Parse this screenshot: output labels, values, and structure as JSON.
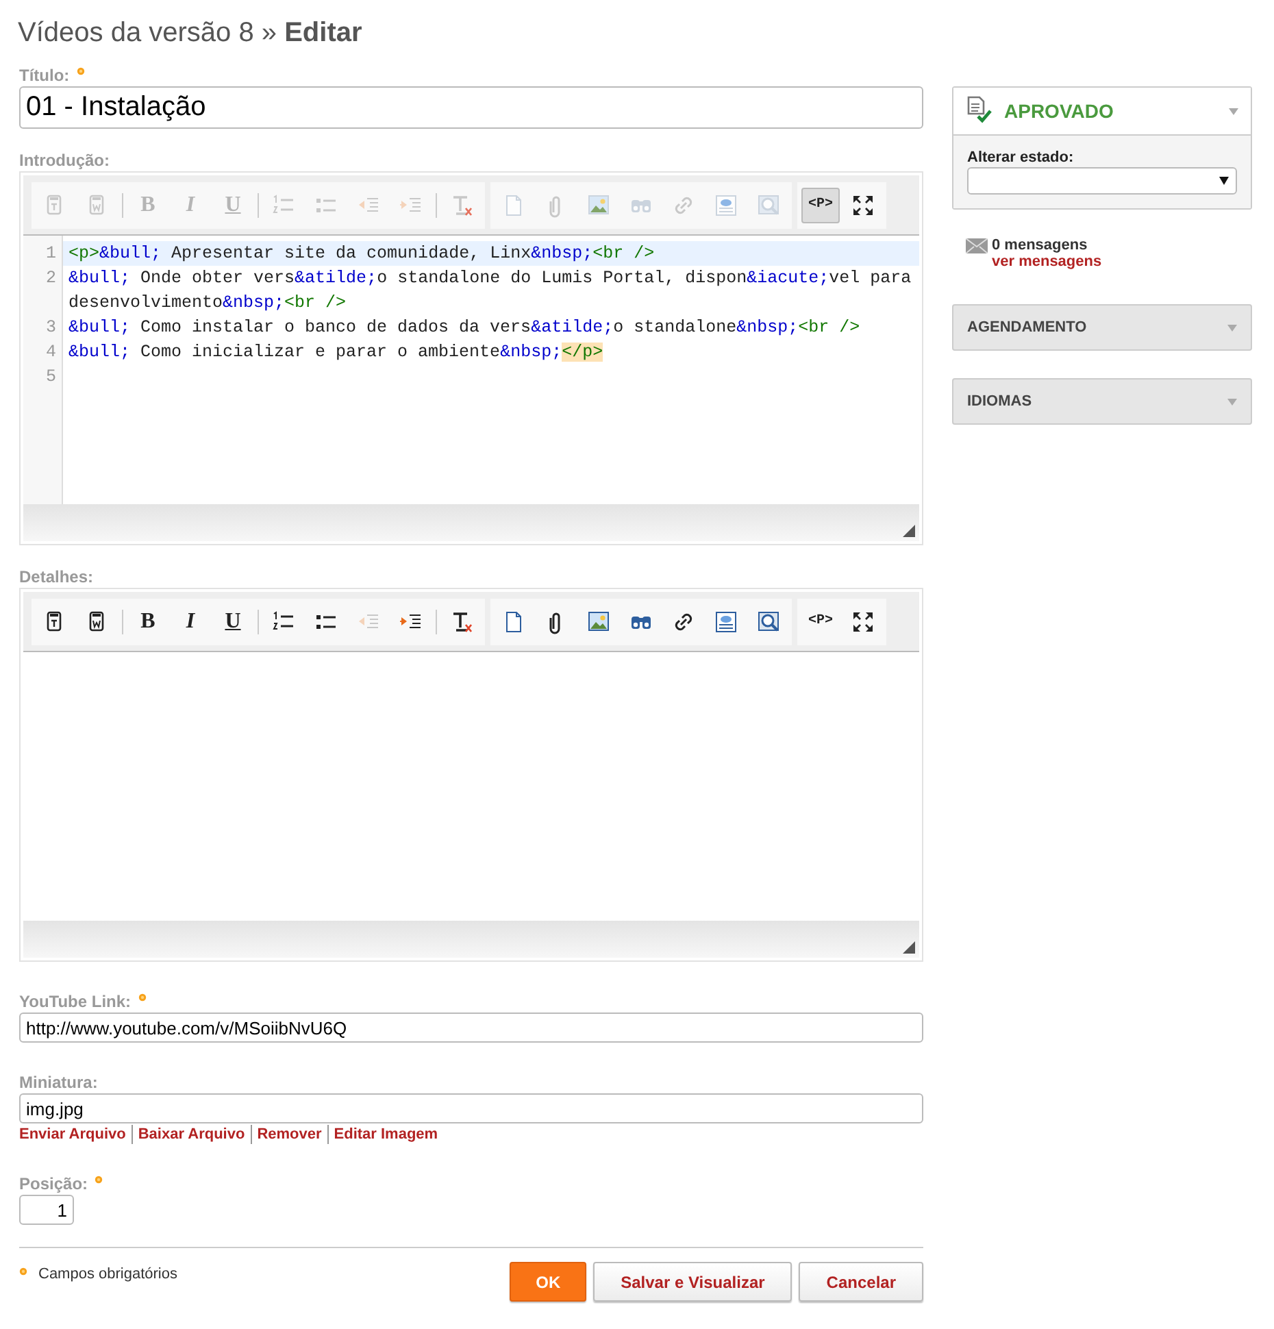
{
  "page_title": "Vídeos da versão 8 » **Editar**",
  "title_field": {
    "label": "Título:",
    "required": true,
    "value": "01 - Instalação"
  },
  "editors": [
    {
      "label": "Introdução:",
      "toolbar": [
        [
          {
            "disabled": true
          },
          {
            "disabled": true
          },
          {
            "label": "B",
            "disabled": true,
            "separated": true
          },
          {
            "label": "I",
            "disabled": true
          },
          {
            "label": "U",
            "disabled": true
          },
          {
            "disabled": true,
            "separated": true
          },
          {
            "disabled": true
          },
          {
            "disabled": true
          },
          {
            "disabled": true
          },
          {
            "disabled": true,
            "separated": true
          }
        ],
        [
          {
            "disabled": true
          },
          {
            "disabled": true
          },
          {
            "disabled": true
          },
          {
            "disabled": true
          },
          {
            "disabled": true
          },
          {
            "disabled": true
          },
          {
            "disabled": true
          }
        ],
        [
          {
            "label": "<P>",
            "disabled": false,
            "selected": true
          },
          {
            "disabled": false
          }
        ]
      ],
      "code_lines": [
        {
          "number": "1",
          "active": true,
          "segments": [
            {
              "kind": "tag",
              "text": "<p>"
            },
            {
              "kind": "entity",
              "text": "&bull;"
            },
            {
              "kind": "text",
              "text": " Apresentar site da comunidade, Linx"
            },
            {
              "kind": "entity",
              "text": "&nbsp;"
            },
            {
              "kind": "tag",
              "text": "<br />"
            }
          ]
        },
        {
          "number": "2",
          "active": false,
          "segments": [
            {
              "kind": "entity",
              "text": "&bull;"
            },
            {
              "kind": "text",
              "text": " Onde obter vers"
            },
            {
              "kind": "entity",
              "text": "&atilde;"
            },
            {
              "kind": "text",
              "text": "o standalone do Lumis Portal, dispon"
            },
            {
              "kind": "entity",
              "text": "&iacute;"
            },
            {
              "kind": "text",
              "text": "vel para desenvolvimento"
            },
            {
              "kind": "entity",
              "text": "&nbsp;"
            },
            {
              "kind": "tag",
              "text": "<br />"
            }
          ]
        },
        {
          "number": "3",
          "active": false,
          "segments": [
            {
              "kind": "entity",
              "text": "&bull;"
            },
            {
              "kind": "text",
              "text": " Como instalar o banco de dados da vers"
            },
            {
              "kind": "entity",
              "text": "&atilde;"
            },
            {
              "kind": "text",
              "text": "o standalone"
            },
            {
              "kind": "entity",
              "text": "&nbsp;"
            },
            {
              "kind": "tag",
              "text": "<br />"
            }
          ]
        },
        {
          "number": "4",
          "active": false,
          "segments": [
            {
              "kind": "entity",
              "text": "&bull;"
            },
            {
              "kind": "text",
              "text": " Como inicializar e parar o ambiente"
            },
            {
              "kind": "entity",
              "text": "&nbsp;"
            },
            {
              "kind": "matched_tag",
              "text": "</p>"
            }
          ]
        },
        {
          "number": "5",
          "active": false
        }
      ]
    },
    {
      "label": "Detalhes:",
      "toolbar": [
        [
          {
            "disabled": false
          },
          {
            "disabled": false
          },
          {
            "label": "B",
            "disabled": false,
            "separated": true
          },
          {
            "label": "I",
            "disabled": false
          },
          {
            "label": "U",
            "disabled": false
          },
          {
            "disabled": false,
            "separated": true
          },
          {
            "disabled": false
          },
          {
            "disabled": true
          },
          {
            "disabled": false
          },
          {
            "disabled": false,
            "separated": true
          }
        ],
        [
          {
            "disabled": false
          },
          {
            "disabled": false
          },
          {
            "disabled": false
          },
          {
            "disabled": false
          },
          {
            "disabled": false
          },
          {
            "disabled": false
          },
          {
            "disabled": false
          }
        ],
        [
          {
            "label": "<P>",
            "disabled": false,
            "selected": false
          },
          {
            "disabled": false
          }
        ]
      ]
    }
  ],
  "youtube_field": {
    "label": "YouTube Link:",
    "required": true,
    "value": "http://www.youtube.com/v/MSoiibNvU6Q"
  },
  "thumbnail_field": {
    "label": "Miniatura:",
    "value": "img.jpg",
    "links": [
      "Enviar Arquivo",
      "Baixar Arquivo",
      "Remover",
      "Editar Imagem"
    ]
  },
  "position_field": {
    "label": "Posição:",
    "required": true,
    "value": "1"
  },
  "required_note": "Campos obrigatórios",
  "buttons": [
    {
      "label": "OK",
      "kind": "primary"
    },
    {
      "label": "Salvar e Visualizar",
      "kind": "secondary"
    },
    {
      "label": "Cancelar",
      "kind": "secondary"
    }
  ],
  "sidebar": {
    "status": {
      "text": "APROVADO",
      "change_label": "Alterar estado:"
    },
    "messages": {
      "count": "0 mensagens",
      "link": "ver mensagens"
    },
    "panels": [
      {
        "title": "AGENDAMENTO",
        "expanded": false
      },
      {
        "title": "IDIOMAS",
        "expanded": false
      }
    ]
  }
}
